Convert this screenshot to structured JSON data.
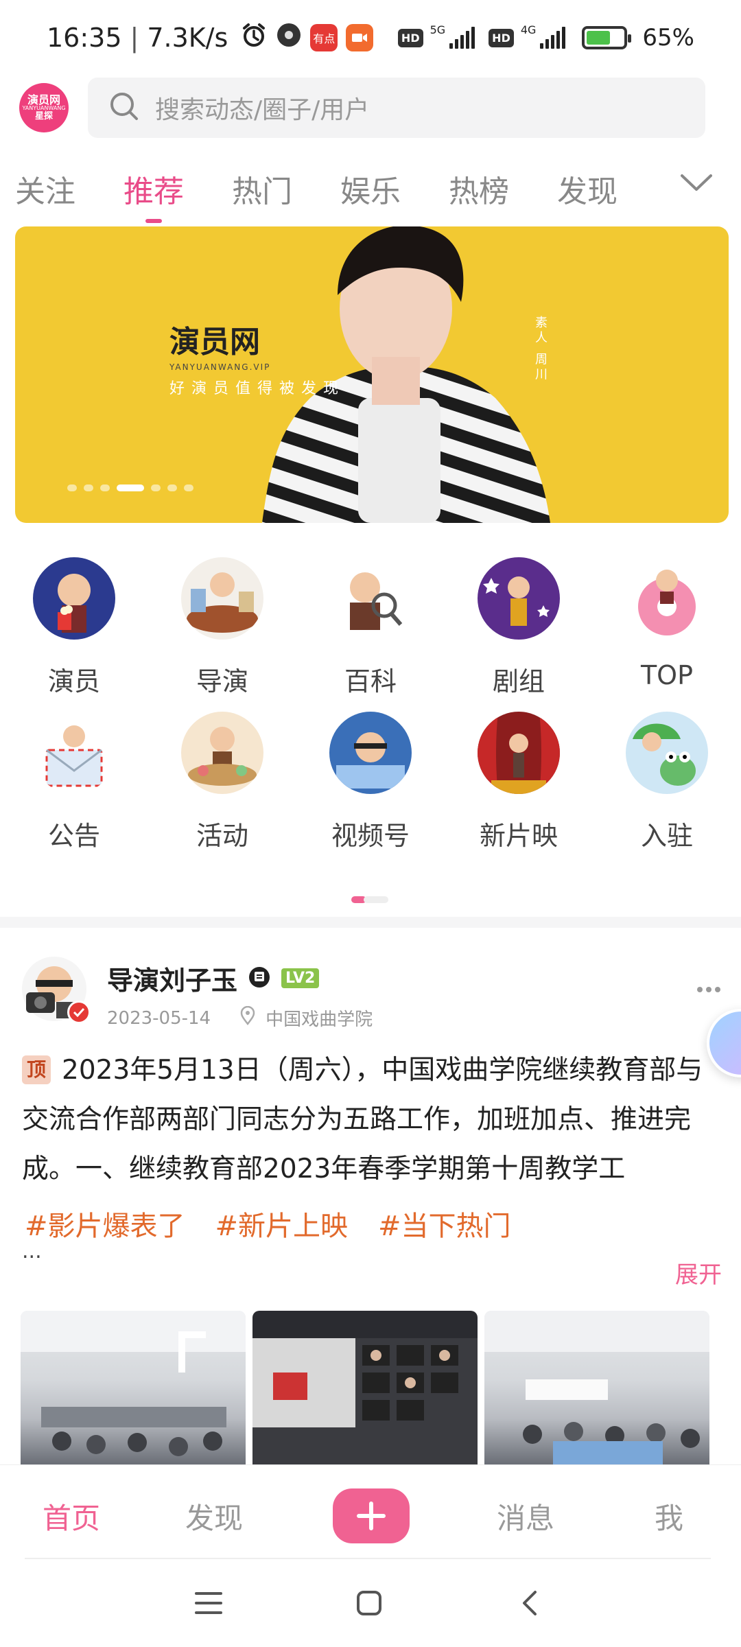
{
  "status_bar": {
    "time": "16:35",
    "net_speed": "7.3K/s",
    "youdian_label": "有点",
    "hd1": "HD",
    "net1": "5G",
    "hd2": "HD",
    "net2": "4G",
    "battery_percent": "65%",
    "battery_level": 0.65
  },
  "header": {
    "logo_text": "演员网",
    "logo_sub": "YANYUANWANG",
    "logo_line2": "星探",
    "search_placeholder": "搜索动态/圈子/用户"
  },
  "tabs": [
    {
      "label": "关注",
      "active": false
    },
    {
      "label": "推荐",
      "active": true
    },
    {
      "label": "热门",
      "active": false
    },
    {
      "label": "娱乐",
      "active": false
    },
    {
      "label": "热榜",
      "active": false
    },
    {
      "label": "发现",
      "active": false
    }
  ],
  "banner": {
    "brand": "演员网",
    "url": "YANYUANWANG.VIP",
    "slogan": "好演员值得被发现",
    "vertical_text": "素人 周川",
    "dot_count": 7,
    "active_dot": 3,
    "bg_color": "#f2c932"
  },
  "categories": [
    {
      "label": "演员",
      "icon": "popcorn-avatar-icon",
      "bg": "#2b3a8f"
    },
    {
      "label": "导演",
      "icon": "director-desk-icon",
      "bg": "#f3efe9"
    },
    {
      "label": "百科",
      "icon": "magnifier-avatar-icon",
      "bg": "#ffffff"
    },
    {
      "label": "剧组",
      "icon": "star-stage-icon",
      "bg": "#5a2d8c"
    },
    {
      "label": "TOP",
      "icon": "donut-avatar-icon",
      "bg": "#ffffff"
    },
    {
      "label": "公告",
      "icon": "envelope-avatar-icon",
      "bg": "#ffffff"
    },
    {
      "label": "活动",
      "icon": "feast-avatar-icon",
      "bg": "#f6e6cf"
    },
    {
      "label": "视频号",
      "icon": "bed-avatar-icon",
      "bg": "#3a6fb8"
    },
    {
      "label": "新片映",
      "icon": "curtain-stage-icon",
      "bg": "#8c1d1d"
    },
    {
      "label": "入驻",
      "icon": "frog-umbrella-icon",
      "bg": "#cfe7f5"
    }
  ],
  "post": {
    "author": "导演刘子玉",
    "level": "LV2",
    "date": "2023-05-14",
    "location": "中国戏曲学院",
    "pin_label": "顶",
    "text": "2023年5月13日（周六），中国戏曲学院继续教育部与交流合作部两部门同志分为五路工作，加班加点、推进完成。一、继续教育部2023年春季学期第十周教学工",
    "tags": [
      "#影片爆表了",
      "#新片上映",
      "#当下热门"
    ],
    "ellipsis": "...",
    "expand_label": "展开"
  },
  "bottom_nav": {
    "home": "首页",
    "discover": "发现",
    "messages": "消息",
    "me": "我",
    "accent_color": "#f06292"
  }
}
